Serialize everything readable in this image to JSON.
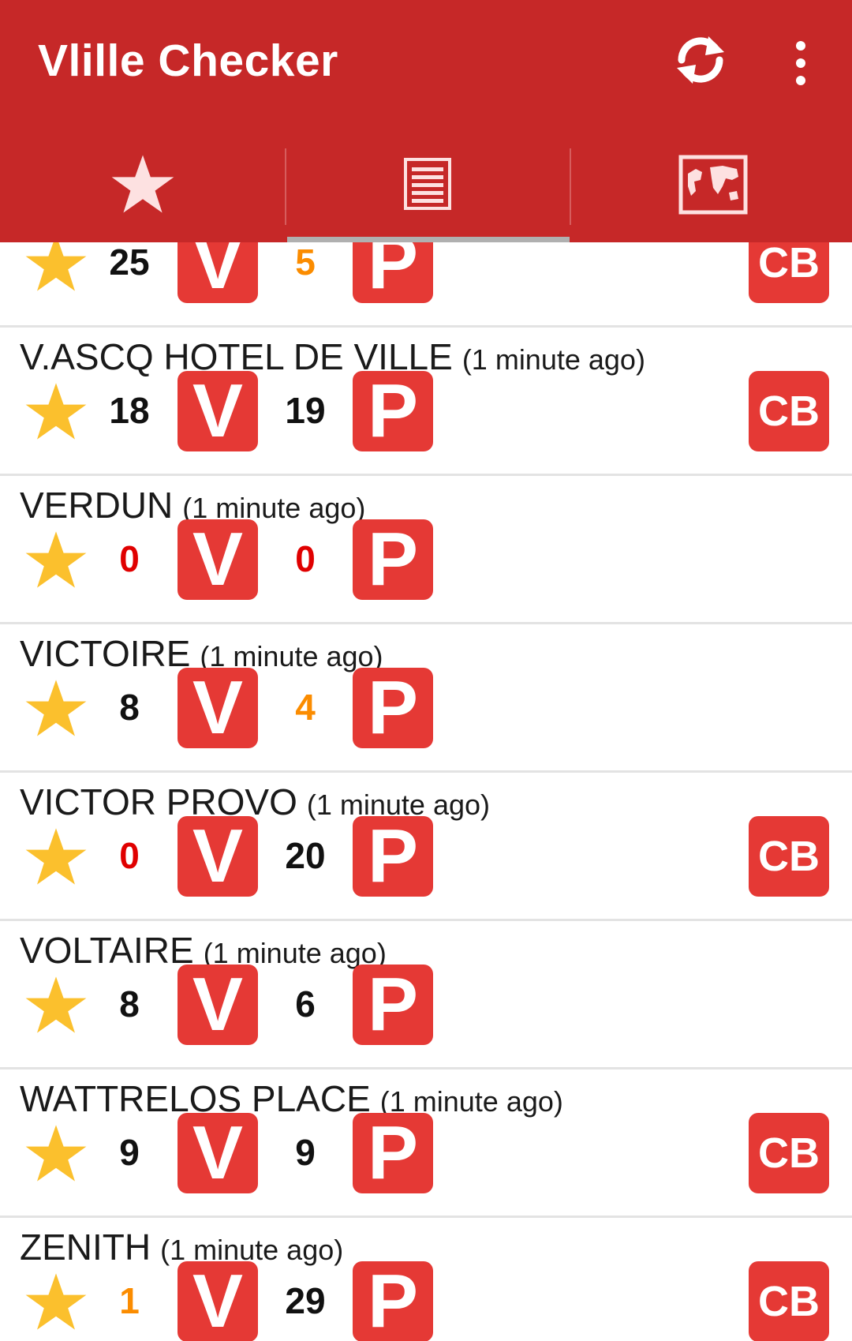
{
  "app": {
    "title": "Vlille Checker"
  },
  "colors": {
    "primary": "#c62828",
    "badge": "#e53935",
    "star": "#fbc02d",
    "zero": "#e00000",
    "low": "#fb8c00",
    "normal": "#111111"
  },
  "toolbar": {
    "refresh_icon": "refresh-icon",
    "menu_icon": "overflow-menu-icon"
  },
  "tabs": [
    {
      "icon": "star-icon",
      "selected": false
    },
    {
      "icon": "list-icon",
      "selected": true
    },
    {
      "icon": "map-icon",
      "selected": false
    }
  ],
  "labels": {
    "bikes": "V",
    "places": "P",
    "card": "CB"
  },
  "stations": [
    {
      "name": "",
      "ago": "",
      "bikes": "25",
      "bikes_status": "normal",
      "places": "5",
      "places_status": "low",
      "cb": true
    },
    {
      "name": "V.ASCQ HOTEL DE VILLE",
      "ago": "(1 minute ago)",
      "bikes": "18",
      "bikes_status": "normal",
      "places": "19",
      "places_status": "normal",
      "cb": true
    },
    {
      "name": "VERDUN",
      "ago": "(1 minute ago)",
      "bikes": "0",
      "bikes_status": "zero",
      "places": "0",
      "places_status": "zero",
      "cb": false
    },
    {
      "name": "VICTOIRE",
      "ago": "(1 minute ago)",
      "bikes": "8",
      "bikes_status": "normal",
      "places": "4",
      "places_status": "low",
      "cb": false
    },
    {
      "name": "VICTOR PROVO",
      "ago": "(1 minute ago)",
      "bikes": "0",
      "bikes_status": "zero",
      "places": "20",
      "places_status": "normal",
      "cb": true
    },
    {
      "name": "VOLTAIRE",
      "ago": "(1 minute ago)",
      "bikes": "8",
      "bikes_status": "normal",
      "places": "6",
      "places_status": "normal",
      "cb": false
    },
    {
      "name": "WATTRELOS PLACE",
      "ago": "(1 minute ago)",
      "bikes": "9",
      "bikes_status": "normal",
      "places": "9",
      "places_status": "normal",
      "cb": true
    },
    {
      "name": "ZENITH",
      "ago": "(1 minute ago)",
      "bikes": "1",
      "bikes_status": "low",
      "places": "29",
      "places_status": "normal",
      "cb": true
    }
  ]
}
